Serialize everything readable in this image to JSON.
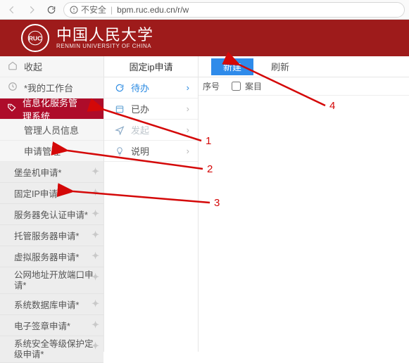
{
  "url": "bpm.ruc.edu.cn/r/w",
  "insecure_label": "不安全",
  "banner": {
    "cn": "中国人民大学",
    "en": "RENMIN UNIVERSITY OF CHINA"
  },
  "sidebar": {
    "collapse_label": "收起",
    "workspace_label": "*我的工作台",
    "it_service_label": "信息化服务管理系统",
    "admin_info_label": "管理人员信息",
    "apply_mgmt_label": "申请管理",
    "submenu": [
      "堡垒机申请*",
      "固定IP申请*",
      "服务器免认证申请*",
      "托管服务器申请*",
      "虚拟服务器申请*",
      "公网地址开放端口申请*",
      "系统数据库申请*",
      "电子签章申请*",
      "系统安全等级保护定级申请*"
    ]
  },
  "mid": {
    "title": "固定ip申请",
    "pending": "待办",
    "done": "已办",
    "sent": "发起",
    "help": "说明"
  },
  "right": {
    "new_label": "新建",
    "refresh_label": "刷新",
    "seq_header": "序号",
    "case_header": "案目"
  },
  "anno": {
    "n1": "1",
    "n2": "2",
    "n3": "3",
    "n4": "4"
  }
}
